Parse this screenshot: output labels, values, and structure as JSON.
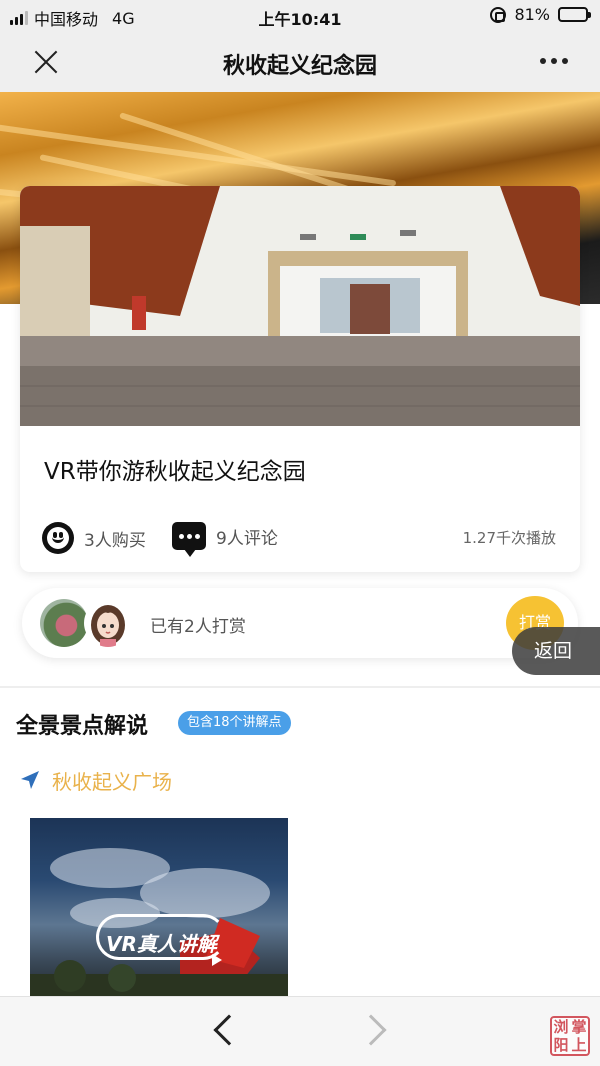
{
  "status_bar": {
    "carrier": "中国移动",
    "network": "4G",
    "time": "上午10:41",
    "battery_percent": "81%",
    "battery_level": 0.81
  },
  "nav": {
    "title": "秋收起义纪念园",
    "close_icon": "close-icon",
    "more_icon": "more-dots-icon"
  },
  "video_card": {
    "title": "VR带你游秋收起义纪念园",
    "purchases": "3人购买",
    "comments": "9人评论",
    "plays": "1.27千次播放"
  },
  "reward": {
    "text": "已有2人打赏",
    "button": "打赏"
  },
  "back_button": "返回",
  "section": {
    "title": "全景景点解说",
    "badge": "包含18个讲解点",
    "spot_name": "秋收起义广场",
    "thumbnail_label": "VR真人讲解"
  },
  "watermark": [
    "掌",
    "浏",
    "上",
    "阳"
  ],
  "colors": {
    "accent_yellow": "#f6c233",
    "spot_gold": "#e9b24b",
    "badge_blue": "#4a9fe8"
  }
}
